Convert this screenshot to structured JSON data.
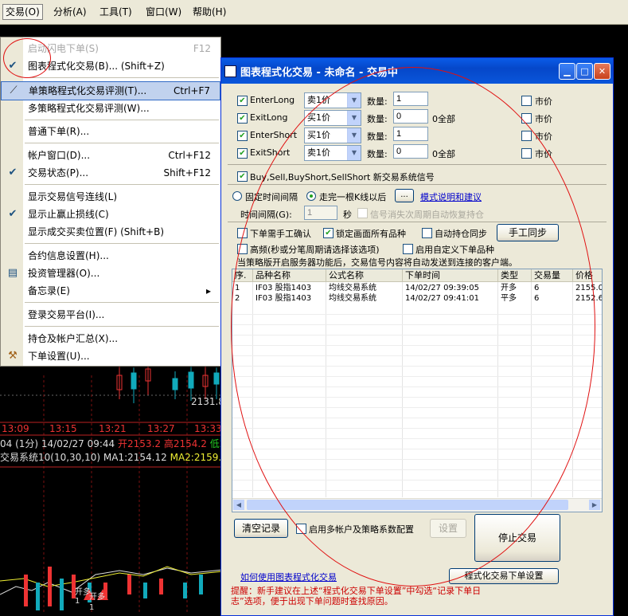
{
  "menubar": [
    {
      "name": "menubar-trade",
      "label": "交易(O)",
      "active": true
    },
    {
      "name": "menubar-analysis",
      "label": "分析(A)"
    },
    {
      "name": "menubar-tools",
      "label": "工具(T)"
    },
    {
      "name": "menubar-window",
      "label": "窗口(W)"
    },
    {
      "name": "menubar-help",
      "label": "帮助(H)"
    }
  ],
  "chart": {
    "price_label": "2131.8",
    "times": [
      "13:09",
      "13:15",
      "13:21",
      "13:27",
      "13:33"
    ],
    "info_line1": {
      "a": "04 (1分) 14/02/27 09:44",
      "open": "开2153.2",
      "high": "高2154.2",
      "low": "低2"
    },
    "info_line2": {
      "a": "交易系统10(10,30,10)",
      "ma1": "MA1:2154.12",
      "ma2": "MA2:2159.5"
    },
    "marks": [
      "开多",
      "开多",
      "1",
      "1"
    ]
  },
  "menu": {
    "items": [
      {
        "label": "启动闪电下单(S)",
        "shortcut": "F12",
        "disabled": true
      },
      {
        "label": "图表程式化交易(B)... (Shift+Z)",
        "shortcut": "",
        "checked": true
      },
      {
        "label": "单策略程式化交易评测(T)...",
        "shortcut": "Ctrl+F7",
        "highlighted": true,
        "icon": "wand-icon"
      },
      {
        "label": "多策略程式化交易评测(W)...",
        "shortcut": ""
      },
      {
        "label": "普通下单(R)...",
        "shortcut": ""
      },
      {
        "label": "帐户窗口(D)...",
        "shortcut": "Ctrl+F12"
      },
      {
        "label": "交易状态(P)...",
        "shortcut": "Shift+F12",
        "checked": true
      },
      {
        "label": "显示交易信号连线(L)",
        "shortcut": ""
      },
      {
        "label": "显示止赢止损线(C)",
        "shortcut": "",
        "checked": true
      },
      {
        "label": "显示成交买卖位置(F)  (Shift+B)",
        "shortcut": ""
      },
      {
        "label": "合约信息设置(H)...",
        "shortcut": ""
      },
      {
        "label": "投资管理器(O)...",
        "shortcut": "",
        "icon": "portfolio-icon"
      },
      {
        "label": "备忘录(E)",
        "shortcut": "▸"
      },
      {
        "label": "登录交易平台(I)...",
        "shortcut": ""
      },
      {
        "label": "持仓及帐户汇总(X)...",
        "shortcut": ""
      },
      {
        "label": "下单设置(U)...",
        "shortcut": "",
        "icon": "tools-icon"
      }
    ]
  },
  "dialog": {
    "title": "图表程式化交易 - 未命名 - 交易中",
    "orders": [
      {
        "name": "EnterLong",
        "price_type": "卖1价",
        "qty_label": "数量:",
        "qty": "1",
        "all": "",
        "market": "市价"
      },
      {
        "name": "ExitLong",
        "price_type": "买1价",
        "qty_label": "数量:",
        "qty": "0",
        "all": "0全部",
        "market": "市价"
      },
      {
        "name": "EnterShort",
        "price_type": "买1价",
        "qty_label": "数量:",
        "qty": "1",
        "all": "",
        "market": "市价"
      },
      {
        "name": "ExitShort",
        "price_type": "卖1价",
        "qty_label": "数量:",
        "qty": "0",
        "all": "0全部",
        "market": "市价"
      }
    ],
    "signal_note": "Buy,Sell,BuyShort,SellShort 新交易系统信号",
    "fixed_interval": "固定时间间隔",
    "after_kline": "走完一根K线以后",
    "dots": "...",
    "mode_link": "模式说明和建议",
    "interval_label": "时间间隔(G):",
    "interval_value": "1",
    "sec": "秒",
    "signal_restore": "信号消失次周期自动恢复持仓",
    "manual_confirm": "下单需手工确认",
    "lock_all": "锁定画面所有品种",
    "auto_sync": "自动持仓同步",
    "manual_sync": "手工同步",
    "hf": "高频(秒或分笔周期请选择该选项)",
    "custom_product": "启用自定义下单品种",
    "server_note": "当策略版开启服务器功能后，交易信号内容将自动发送到连接的客户端。",
    "columns": [
      "序.",
      "品种名称",
      "公式名称",
      "下单时间",
      "类型",
      "交易量",
      "价格"
    ],
    "rows": [
      [
        "1",
        "IF03 股指1403",
        "均线交易系统",
        "14/02/27 09:39:05",
        "开多",
        "6",
        "2155.0"
      ],
      [
        "2",
        "IF03 股指1403",
        "均线交易系统",
        "14/02/27 09:41:01",
        "平多",
        "6",
        "2152.6"
      ]
    ],
    "clear_log": "清空记录",
    "multi_account": "启用多帐户及策略系数配置",
    "settings": "设置",
    "stop_trade": "停止交易",
    "howto_link": "如何使用图表程式化交易",
    "order_settings": "程式化交易下单设置",
    "tip": "提醒：新手建议在上述“程式化交易下单设置”中勾选“记录下单日志”选项，便于出现下单问题时查找原因。"
  }
}
